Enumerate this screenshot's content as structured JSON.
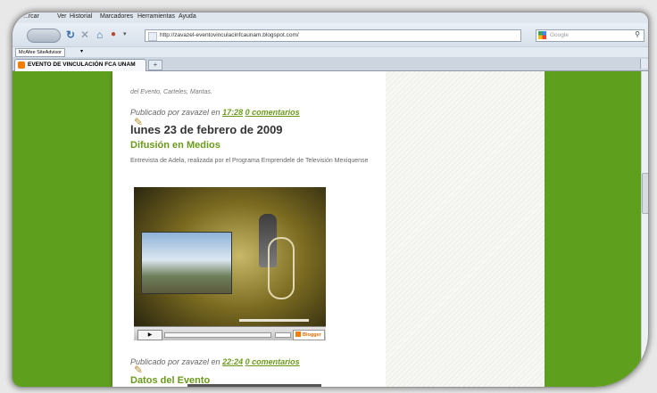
{
  "menubar": {
    "items": [
      "...rcar",
      "Ver",
      "Historial",
      "Marcadores",
      "Herramientas",
      "Ayuda"
    ]
  },
  "navbar": {
    "url": "http://zavazel-eventovinculacinfcaunam.blogspot.com/",
    "search_placeholder": "Google"
  },
  "toolbar": {
    "mcafee_label": "McAfee SiteAdvisor"
  },
  "tabs": {
    "active_title": "EVENTO DE VINCULACIÓN FCA UNAM",
    "new_tab": "+"
  },
  "blog": {
    "top_cut_text": "del Evento, Carteles, Mantas.",
    "post1_footer_prefix": "Publicado por zavazel en",
    "post1_time": "17:28",
    "post1_comments": "0 comentarios",
    "date_header": "lunes 23 de febrero de 2009",
    "post2_title": "Difusión en Medios",
    "post2_body": "Entrevista de Adela, realizada por el Programa Emprendele de Televisión Mexiquense",
    "video_badge": "Blogger",
    "post2_footer_prefix": "Publicado por zavazel en",
    "post2_time": "22:24",
    "post2_comments": "0 comentarios",
    "post3_title": "Datos del Evento"
  },
  "colors": {
    "page_background_green": "#5f9f1e",
    "link_green": "#6a9a1c"
  }
}
